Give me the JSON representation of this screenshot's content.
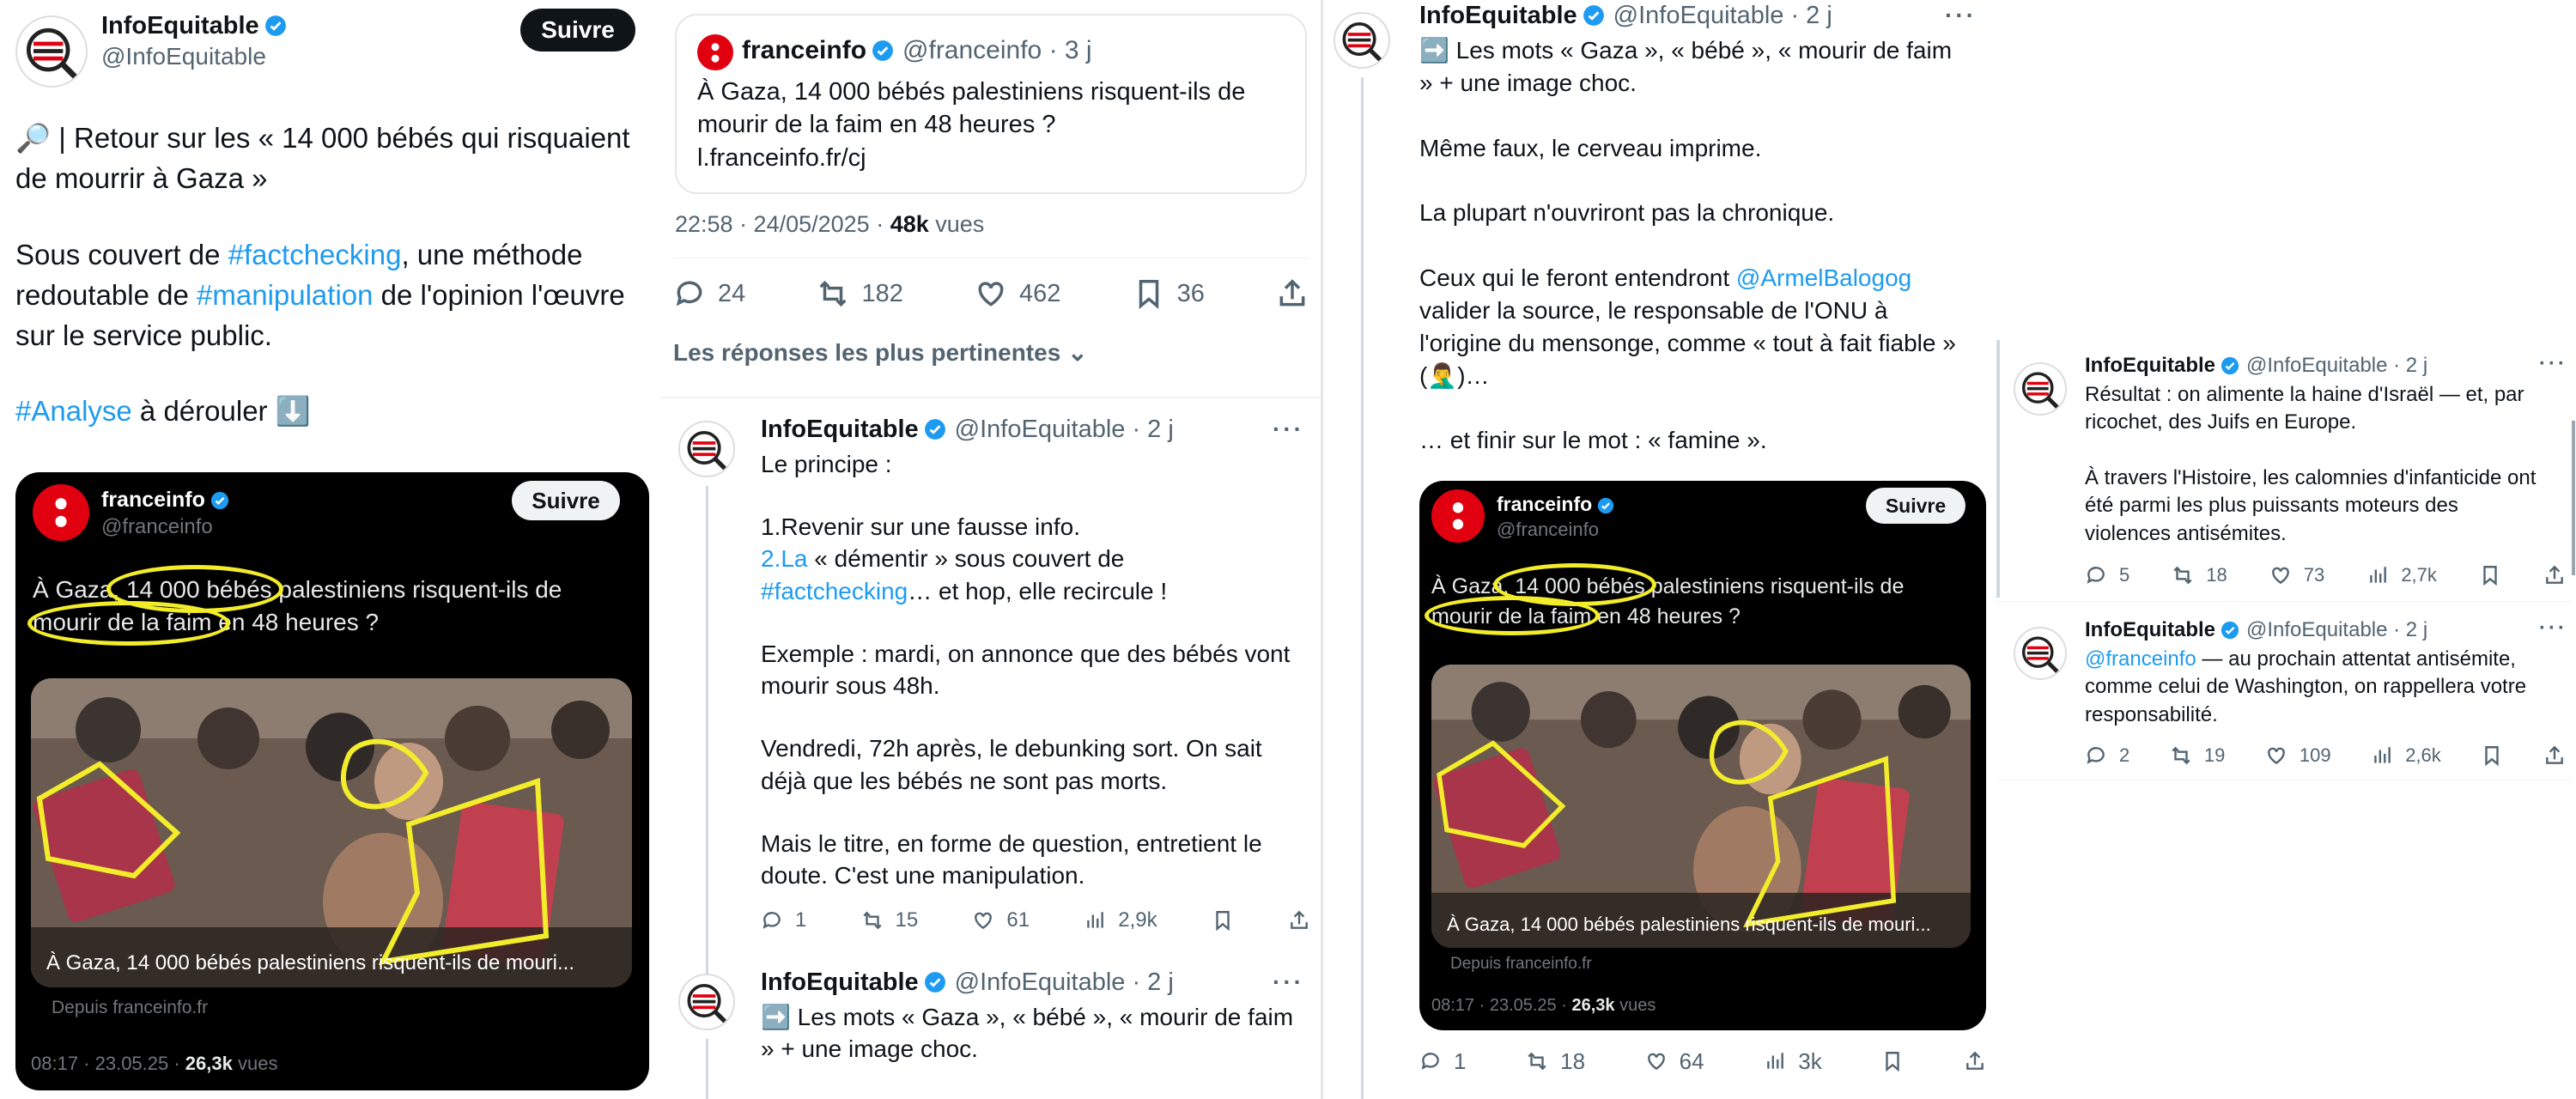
{
  "p1": {
    "name": "InfoEquitable",
    "handle": "@InfoEquitable",
    "follow": "Suivre",
    "t1a": "🔎 | Retour sur les « 14 000 bébés qui risquaient de mourrir à Gaza »",
    "t2a": "Sous couvert de ",
    "t2b": "#factchecking",
    "t2c": ", une méthode redoutable de ",
    "t2d": "#manipulation",
    "t2e": " de l'opinion l'œuvre sur le service public.",
    "t3a": "#Analyse",
    "t3b": " à dérouler ⬇️",
    "card": {
      "name": "franceinfo",
      "handle": "@franceinfo",
      "follow": "Suivre",
      "text": "À Gaza, 14 000 bébés palestiniens risquent-ils de mourir de la faim en 48 heures ?",
      "caption": "À Gaza, 14 000 bébés palestiniens risquent-ils de mouri...",
      "source": "Depuis franceinfo.fr",
      "time": "08:17 · 23.05.25 · ",
      "views": "26,3k",
      "views_lbl": " vues"
    }
  },
  "p2": {
    "quote": {
      "name": "franceinfo",
      "handle": "@franceinfo · 3 j",
      "text": "À Gaza, 14 000 bébés palestiniens risquent-ils de mourir de la faim en 48 heures ?\nl.franceinfo.fr/cj"
    },
    "time": "22:58 · 24/05/2025 · ",
    "views": "48k",
    "views_lbl": " vues",
    "stats": {
      "replies": "24",
      "retweets": "182",
      "likes": "462",
      "bookmarks": "36"
    },
    "sort": "Les réponses les plus pertinentes",
    "r1": {
      "name": "InfoEquitable",
      "handle": "@InfoEquitable · 2 j",
      "l1": "Le principe :",
      "l2": "1.Revenir sur une fausse info.",
      "l3a": "2.La",
      "l3b": " « démentir » sous couvert de",
      "l4a": "#factchecking",
      "l4b": "… et hop, elle recircule !",
      "l5": "Exemple : mardi, on annonce que des bébés vont mourir sous 48h.",
      "l6": "Vendredi, 72h après, le debunking sort. On sait déjà que les bébés ne sont pas morts.",
      "l7": "Mais le titre, en forme de question, entretient le doute. C'est une manipulation.",
      "replies": "1",
      "retweets": "15",
      "likes": "61",
      "views": "2,9k"
    },
    "r2": {
      "name": "InfoEquitable",
      "handle": "@InfoEquitable · 2 j",
      "text": "➡️ Les mots « Gaza », « bébé », « mourir de faim » + une image choc."
    }
  },
  "p3": {
    "name": "InfoEquitable",
    "handle": "@InfoEquitable · 2 j",
    "l1": "➡️ Les mots « Gaza », « bébé », « mourir de faim » + une image choc.",
    "l2": "Même faux, le cerveau imprime.",
    "l3": "La plupart n'ouvriront pas la chronique.",
    "l4a": "Ceux qui le feront entendront ",
    "l4b": "@ArmelBalogog",
    "l4c": " valider la source, le responsable de l'ONU à l'origine du mensonge, comme « tout à fait fiable » (🤦‍♂️)…",
    "l5": "… et finir sur le mot : « famine ».",
    "card": {
      "name": "franceinfo",
      "handle": "@franceinfo",
      "follow": "Suivre",
      "text": "À Gaza, 14 000 bébés palestiniens risquent-ils de mourir de la faim en 48 heures ?",
      "caption": "À Gaza, 14 000 bébés palestiniens risquent-ils de mouri...",
      "source": "Depuis franceinfo.fr",
      "time": "08:17 · 23.05.25 · ",
      "views": "26,3k",
      "views_lbl": " vues"
    },
    "replies": "1",
    "retweets": "18",
    "likes": "64",
    "views": "3k"
  },
  "p4": {
    "r1": {
      "name": "InfoEquitable",
      "handle": "@InfoEquitable · 2 j",
      "l1": "Résultat : on alimente la haine d'Israël — et, par ricochet, des Juifs en Europe.",
      "l2": "À travers l'Histoire, les calomnies d'infanticide ont été parmi les plus puissants moteurs des violences antisémites.",
      "replies": "5",
      "retweets": "18",
      "likes": "73",
      "views": "2,7k"
    },
    "r2": {
      "name": "InfoEquitable",
      "handle": "@InfoEquitable · 2 j",
      "la": "@franceinfo",
      "lb": " — au prochain attentat antisémite, comme celui de Washington, on rappellera votre responsabilité.",
      "replies": "2",
      "retweets": "19",
      "likes": "109",
      "views": "2,6k"
    }
  },
  "colors": {
    "link": "#1d9bf0",
    "verified": "#1d9bf0",
    "highlight": "#f2ec2a",
    "franceinfo": "#e1000f"
  }
}
